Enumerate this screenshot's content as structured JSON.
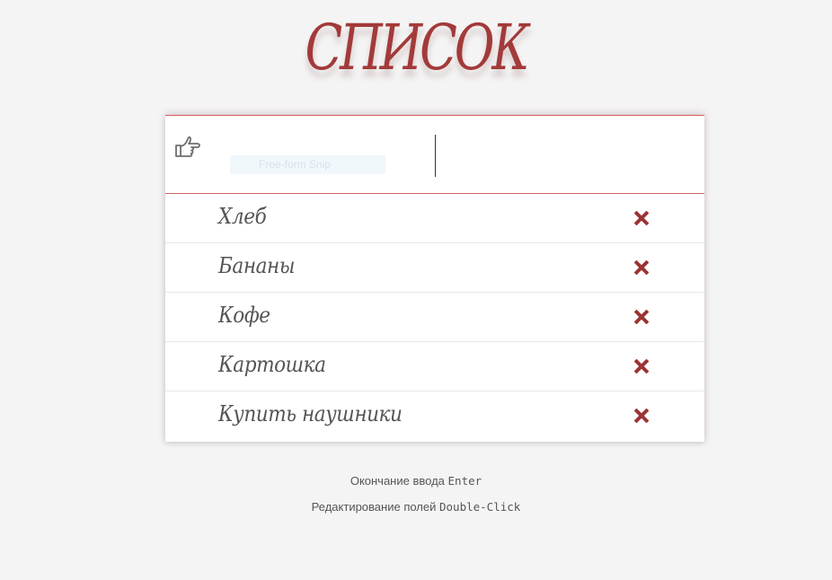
{
  "header": {
    "title": "СПИСОК"
  },
  "input": {
    "icon": "pointing-hand-icon",
    "value": "",
    "overlay_text": "Free-form Snip"
  },
  "items": [
    {
      "label": "Хлеб",
      "delete_icon": "close-x-icon"
    },
    {
      "label": "Бананы",
      "delete_icon": "close-x-icon"
    },
    {
      "label": "Кофе",
      "delete_icon": "close-x-icon"
    },
    {
      "label": "Картошка",
      "delete_icon": "close-x-icon"
    },
    {
      "label": "Купить наушники",
      "delete_icon": "close-x-icon"
    }
  ],
  "hints": [
    {
      "text": "Окончание ввода",
      "key": "Enter"
    },
    {
      "text": "Редактирование полей",
      "key": "Double-Click"
    }
  ],
  "colors": {
    "accent": "#a33a3a",
    "delete": "#9b3434",
    "background": "#f4f4f4",
    "panel": "#ffffff",
    "divider": "#cd6767"
  }
}
